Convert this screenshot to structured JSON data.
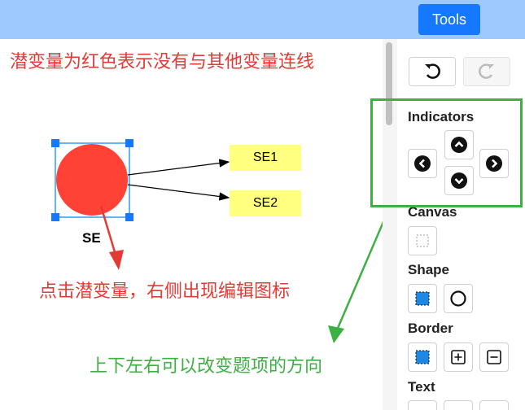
{
  "toolbar": {
    "tools_label": "Tools"
  },
  "annotations": {
    "top": {
      "text": "潜变量为红色表示没有与其他变量连线",
      "color": "#e53935"
    },
    "middle": {
      "text": "点击潜变量，右侧出现编辑图标",
      "color": "#e53935"
    },
    "bottom": {
      "text": "上下左右可以改变题项的方向",
      "color": "#3cb043"
    }
  },
  "diagram": {
    "latent": {
      "name": "SE",
      "color": "#ff4136"
    },
    "indicators": [
      {
        "label": "SE1"
      },
      {
        "label": "SE2"
      }
    ]
  },
  "panel": {
    "sections": {
      "indicators": "Indicators",
      "canvas": "Canvas",
      "shape": "Shape",
      "border": "Border",
      "text": "Text"
    }
  },
  "colors": {
    "accent": "#1677ff",
    "topbar": "#9ec9ff",
    "green": "#3cb043",
    "red_arrow": "#e53935"
  }
}
